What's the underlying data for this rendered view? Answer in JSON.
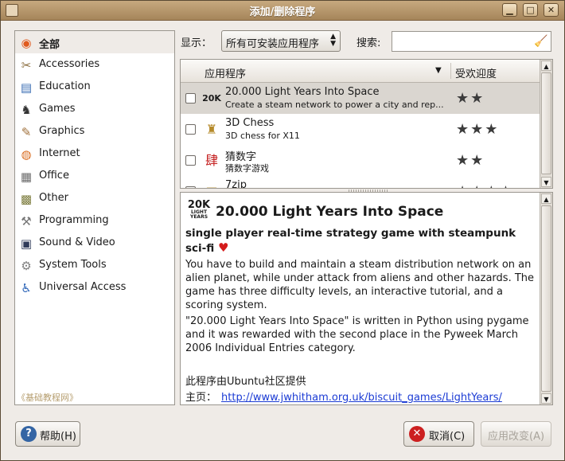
{
  "window": {
    "title": "添加/删除程序",
    "controls": {
      "minimize": "▁",
      "maximize": "□",
      "close": "✕"
    }
  },
  "sidebar": {
    "items": [
      {
        "label": "全部",
        "icon": "ubuntu-logo-icon",
        "glyph": "◉",
        "color": "#e05a1e",
        "selected": true
      },
      {
        "label": "Accessories",
        "icon": "accessories-icon",
        "glyph": "✂",
        "color": "#8a6b3c"
      },
      {
        "label": "Education",
        "icon": "education-icon",
        "glyph": "▤",
        "color": "#3a6db3"
      },
      {
        "label": "Games",
        "icon": "games-icon",
        "glyph": "♞",
        "color": "#333333"
      },
      {
        "label": "Graphics",
        "icon": "graphics-icon",
        "glyph": "✎",
        "color": "#a0703a"
      },
      {
        "label": "Internet",
        "icon": "internet-icon",
        "glyph": "◍",
        "color": "#d96b1e"
      },
      {
        "label": "Office",
        "icon": "office-icon",
        "glyph": "▦",
        "color": "#6b6b6b"
      },
      {
        "label": "Other",
        "icon": "other-icon",
        "glyph": "▩",
        "color": "#7a7a3a"
      },
      {
        "label": "Programming",
        "icon": "programming-icon",
        "glyph": "⚒",
        "color": "#777777"
      },
      {
        "label": "Sound & Video",
        "icon": "sound-video-icon",
        "glyph": "▣",
        "color": "#2f3b5a"
      },
      {
        "label": "System Tools",
        "icon": "system-tools-icon",
        "glyph": "⚙",
        "color": "#7f7f7f"
      },
      {
        "label": "Universal Access",
        "icon": "universal-access-icon",
        "glyph": "♿",
        "color": "#2f66b8"
      }
    ],
    "footer": "《基础教程网》"
  },
  "filter": {
    "show_label": "显示：",
    "show_value": "所有可安装应用程序",
    "search_label": "搜索:",
    "search_value": ""
  },
  "list": {
    "headers": {
      "app": "应用程序",
      "popularity": "受欢迎度"
    },
    "rows": [
      {
        "name": "20.000 Light Years Into Space",
        "desc": "Create a steam network to power a city and rep...",
        "stars": "★★",
        "icon": "lightyears-icon",
        "glyph": "20K",
        "selected": true
      },
      {
        "name": "3D Chess",
        "desc": "3D chess for X11",
        "stars": "★★★",
        "icon": "chess-icon",
        "glyph": "♜"
      },
      {
        "name": "猜数字",
        "desc": "猜数字游戏",
        "stars": "★★",
        "icon": "guess-number-icon",
        "glyph": "肆"
      },
      {
        "name": "7zip",
        "desc": "",
        "stars": "★★★★",
        "icon": "archive-icon",
        "glyph": "▤"
      }
    ]
  },
  "detail": {
    "logo_main": "20K",
    "logo_sub": "LIGHT YEARS",
    "name": "20.000 Light Years Into Space",
    "summary": "single player real-time strategy game with steampunk sci-fi",
    "description_1": "You have to build and maintain a steam distribution network on an alien planet, while under attack from aliens and other hazards. The game has three difficulty levels, an interactive tutorial, and a scoring system.",
    "description_2": "\"20.000 Light Years Into Space\" is written in Python using pygame and it was rewarded with the second place in the Pyweek March 2006 Individual Entries category.",
    "provider": "此程序由Ubuntu社区提供",
    "homepage_label": "主页：",
    "homepage_url": "http://www.jwhitham.org.uk/biscuit_games/LightYears/"
  },
  "buttons": {
    "help": "帮助(H)",
    "cancel": "取消(C)",
    "apply": "应用改变(A)"
  }
}
